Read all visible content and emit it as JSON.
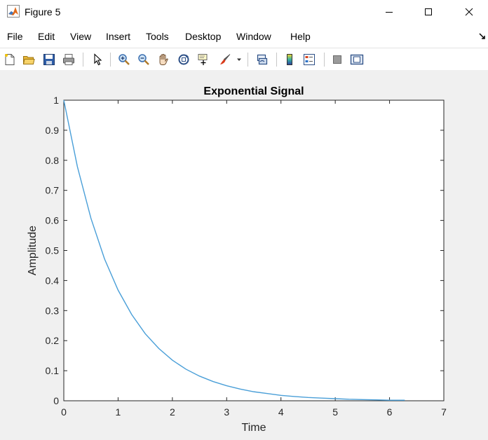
{
  "window": {
    "title": "Figure 5",
    "app_icon": "matlab-icon"
  },
  "menu": {
    "items": [
      "File",
      "Edit",
      "View",
      "Insert",
      "Tools",
      "Desktop",
      "Window",
      "Help"
    ]
  },
  "toolbar": {
    "items": [
      "new-figure-icon",
      "open-file-icon",
      "save-icon",
      "print-icon",
      "select-arrow-icon",
      "zoom-in-icon",
      "zoom-out-icon",
      "pan-hand-icon",
      "rotate-3d-icon",
      "data-cursor-icon",
      "brush-icon",
      "link-plot-icon",
      "colorbar-icon",
      "legend-icon",
      "hide-plot-tools-icon",
      "show-plot-tools-icon"
    ]
  },
  "chart_data": {
    "type": "line",
    "title": "Exponential Signal",
    "xlabel": "Time",
    "ylabel": "Amplitude",
    "xlim": [
      0,
      7
    ],
    "ylim": [
      0,
      1
    ],
    "xticks": [
      "0",
      "1",
      "2",
      "3",
      "4",
      "5",
      "6",
      "7"
    ],
    "yticks": [
      "0",
      "0.1",
      "0.2",
      "0.3",
      "0.4",
      "0.5",
      "0.6",
      "0.7",
      "0.8",
      "0.9",
      "1"
    ],
    "grid": false,
    "series": [
      {
        "color": "#4a9fd8",
        "x": [
          0,
          0.25,
          0.5,
          0.75,
          1,
          1.25,
          1.5,
          1.75,
          2,
          2.25,
          2.5,
          2.75,
          3,
          3.25,
          3.5,
          3.75,
          4,
          4.25,
          4.5,
          4.75,
          5,
          5.25,
          5.5,
          5.75,
          6,
          6.28
        ],
        "y": [
          1,
          0.779,
          0.607,
          0.472,
          0.368,
          0.287,
          0.223,
          0.174,
          0.135,
          0.105,
          0.082,
          0.064,
          0.05,
          0.039,
          0.03,
          0.024,
          0.018,
          0.014,
          0.011,
          0.009,
          0.007,
          0.005,
          0.004,
          0.003,
          0.002,
          0.002
        ]
      }
    ]
  }
}
